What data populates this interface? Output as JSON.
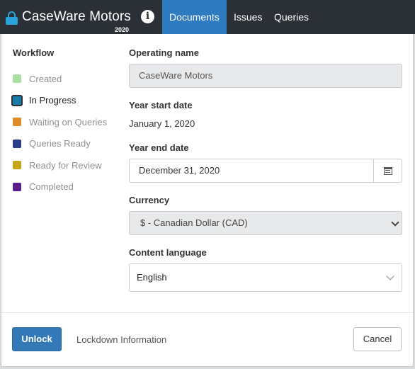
{
  "header": {
    "brand_icon": "lock-icon",
    "title": "CaseWare Motors",
    "year": "2020",
    "info_icon": "info-icon",
    "tabs": [
      {
        "label": "Documents",
        "active": true
      },
      {
        "label": "Issues",
        "active": false
      },
      {
        "label": "Queries",
        "active": false
      }
    ]
  },
  "workflow": {
    "title": "Workflow",
    "items": [
      {
        "label": "Created",
        "color": "#a8e0a0"
      },
      {
        "label": "In Progress",
        "color": "#1a7aa8",
        "current": true
      },
      {
        "label": "Waiting on Queries",
        "color": "#e08a2a"
      },
      {
        "label": "Queries Ready",
        "color": "#2a3f88"
      },
      {
        "label": "Ready for Review",
        "color": "#c6a516"
      },
      {
        "label": "Completed",
        "color": "#5a1f8a"
      }
    ]
  },
  "form": {
    "operating_name_label": "Operating name",
    "operating_name_value": "CaseWare Motors",
    "year_start_label": "Year start date",
    "year_start_value": "January 1, 2020",
    "year_end_label": "Year end date",
    "year_end_value": "December 31, 2020",
    "calendar_icon": "calendar-icon",
    "currency_label": "Currency",
    "currency_value": "$ - Canadian Dollar (CAD)",
    "language_label": "Content language",
    "language_value": "English"
  },
  "footer": {
    "unlock_label": "Unlock",
    "lockdown_label": "Lockdown Information",
    "cancel_label": "Cancel"
  },
  "colors": {
    "topbar": "#2b3036",
    "accent": "#2f7bbf",
    "lock": "#29a3dc"
  }
}
